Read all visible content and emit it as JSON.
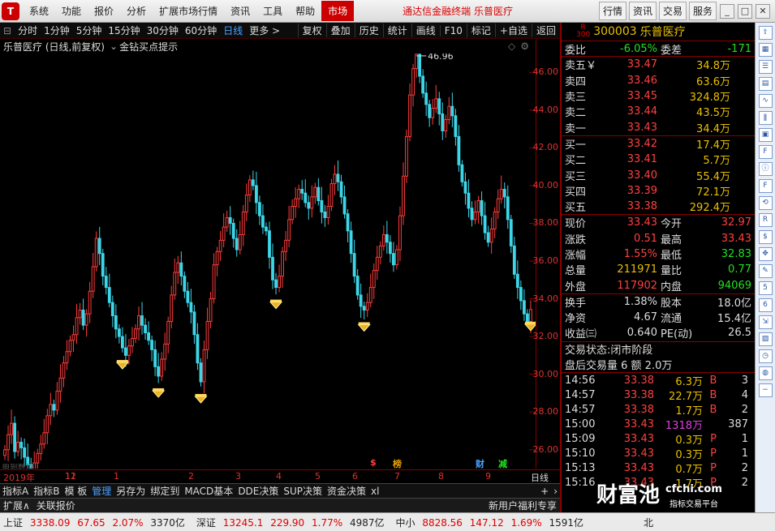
{
  "menubar": {
    "items": [
      "系统",
      "功能",
      "报价",
      "分析",
      "扩展市场行情",
      "资讯",
      "工具",
      "帮助"
    ],
    "market": "市场",
    "app_title": "通达信金融终端  乐普医疗",
    "right_buttons": [
      "行情",
      "资讯",
      "交易",
      "服务"
    ]
  },
  "toolbar": {
    "periods": [
      "分时",
      "1分钟",
      "5分钟",
      "15分钟",
      "30分钟",
      "60分钟",
      "日线",
      "更多 >"
    ],
    "active_period": "日线",
    "buttons": [
      "复权",
      "叠加",
      "历史",
      "统计",
      "画线",
      "F10",
      "标记",
      "+自选",
      "返回"
    ]
  },
  "chart": {
    "title": "乐普医疗 (日线,前复权)",
    "indicator": "金钻买点提示",
    "high_label": "46.96",
    "low_label": "24.80",
    "fade_text": "用到数据",
    "y_ticks": [
      "46.00",
      "44.00",
      "42.00",
      "40.00",
      "38.00",
      "36.00",
      "34.00",
      "32.00",
      "30.00",
      "28.00",
      "26.00"
    ],
    "x_labels": [
      "2019年",
      "11",
      "12",
      "1",
      "2",
      "3",
      "4",
      "5",
      "6",
      "7",
      "8",
      "9"
    ],
    "period_label": "日线",
    "events": [
      {
        "text": "$",
        "color": "#ff4040"
      },
      {
        "text": "榜",
        "color": "#e8a000"
      },
      {
        "text": "财",
        "color": "#4aa3ff"
      },
      {
        "text": "减",
        "color": "#22e022"
      }
    ]
  },
  "chart_data": {
    "type": "candlestick",
    "ylim": [
      25,
      47
    ],
    "high": 46.96,
    "low": 24.8,
    "closes": [
      26.0,
      26.8,
      27.4,
      25.9,
      26.4,
      26.1,
      25.6,
      25.2,
      24.9,
      25.3,
      25.8,
      26.3,
      26.9,
      27.8,
      28.4,
      28.1,
      29.1,
      29.8,
      30.6,
      31.2,
      31.8,
      32.1,
      33.0,
      33.4,
      32.6,
      33.2,
      34.4,
      35.7,
      37.2,
      36.4,
      35.2,
      34.6,
      33.8,
      33.1,
      32.4,
      32.0,
      31.4,
      31.0,
      31.5,
      31.9,
      32.4,
      33.1,
      32.6,
      32.2,
      31.8,
      31.3,
      30.4,
      29.9,
      30.8,
      31.6,
      32.8,
      34.2,
      35.4,
      35.9,
      35.2,
      34.4,
      33.8,
      33.3,
      32.1,
      30.6,
      29.6,
      31.3,
      32.8,
      34.0,
      35.8,
      36.5,
      37.1,
      37.8,
      38.3,
      38.0,
      37.2,
      36.6,
      37.4,
      38.6,
      39.5,
      40.3,
      40.0,
      39.1,
      38.4,
      37.8,
      37.6,
      36.2,
      35.0,
      34.6,
      35.2,
      36.5,
      37.1,
      38.2,
      38.9,
      39.3,
      39.8,
      39.6,
      39.1,
      38.8,
      39.4,
      39.9,
      39.2,
      38.6,
      38.3,
      38.9,
      40.1,
      40.6,
      40.2,
      39.4,
      38.5,
      37.6,
      36.4,
      35.2,
      34.2,
      33.6,
      33.4,
      33.8,
      34.6,
      35.5,
      36.2,
      36.8,
      37.4,
      37.0,
      36.4,
      35.8,
      36.6,
      38.4,
      40.5,
      42.6,
      44.8,
      46.2,
      46.96,
      45.8,
      44.9,
      44.3,
      43.6,
      44.1,
      44.6,
      43.8,
      42.9,
      43.5,
      44.2,
      43.7,
      42.6,
      41.1,
      40.2,
      39.6,
      38.8,
      38.2,
      38.6,
      39.2,
      38.4,
      37.5,
      37.0,
      37.7,
      38.6,
      39.3,
      39.8,
      39.4,
      38.2,
      36.8,
      35.3,
      34.6,
      33.9,
      33.2,
      32.8,
      33.43
    ]
  },
  "quote": {
    "stock_code": "300003",
    "stock_name": "乐普医疗",
    "r_mark": "R",
    "r_num": "300",
    "weibi_label": "委比",
    "weibi": "-6.05%",
    "weicha_label": "委差",
    "weicha": "-171",
    "asks": [
      {
        "label": "卖五￥",
        "price": "33.47",
        "vol": "34.8万"
      },
      {
        "label": "卖四",
        "price": "33.46",
        "vol": "63.6万"
      },
      {
        "label": "卖三",
        "price": "33.45",
        "vol": "324.8万"
      },
      {
        "label": "卖二",
        "price": "33.44",
        "vol": "43.5万"
      },
      {
        "label": "卖一",
        "price": "33.43",
        "vol": "34.4万"
      }
    ],
    "bids": [
      {
        "label": "买一",
        "price": "33.42",
        "vol": "17.4万"
      },
      {
        "label": "买二",
        "price": "33.41",
        "vol": "5.7万"
      },
      {
        "label": "买三",
        "price": "33.40",
        "vol": "55.4万"
      },
      {
        "label": "买四",
        "price": "33.39",
        "vol": "72.1万"
      },
      {
        "label": "买五",
        "price": "33.38",
        "vol": "292.4万"
      }
    ],
    "stats": [
      {
        "l1": "现价",
        "v1": "33.43",
        "c1": "red",
        "l2": "今开",
        "v2": "32.97",
        "c2": "red"
      },
      {
        "l1": "涨跌",
        "v1": "0.51",
        "c1": "red",
        "l2": "最高",
        "v2": "33.43",
        "c2": "red"
      },
      {
        "l1": "涨幅",
        "v1": "1.55%",
        "c1": "red",
        "l2": "最低",
        "v2": "32.83",
        "c2": "green"
      },
      {
        "l1": "总量",
        "v1": "211971",
        "c1": "yellow",
        "l2": "量比",
        "v2": "0.77",
        "c2": "green"
      },
      {
        "l1": "外盘",
        "v1": "117902",
        "c1": "red",
        "l2": "内盘",
        "v2": "94069",
        "c2": "green"
      }
    ],
    "stats2": [
      {
        "l1": "换手",
        "v1": "1.38%",
        "l2": "股本",
        "v2": "18.0亿"
      },
      {
        "l1": "净资",
        "v1": "4.67",
        "l2": "流通",
        "v2": "15.4亿"
      },
      {
        "l1": "收益㈢",
        "v1": "0.640",
        "l2": "PE(动)",
        "v2": "26.5"
      }
    ],
    "trade_status": "交易状态:闭市阶段",
    "after_hours": "盘后交易量 6 额 2.0万",
    "ticks": [
      {
        "time": "14:56",
        "price": "33.38",
        "vol": "6.3万",
        "bs": "B",
        "n": "3",
        "vc": "yellow"
      },
      {
        "time": "14:57",
        "price": "33.38",
        "vol": "22.7万",
        "bs": "B",
        "n": "4",
        "vc": "yellow"
      },
      {
        "time": "14:57",
        "price": "33.38",
        "vol": "1.7万",
        "bs": "B",
        "n": "2",
        "vc": "yellow"
      },
      {
        "time": "15:00",
        "price": "33.43",
        "vol": "1318万",
        "bs": "",
        "n": "387",
        "vc": "magenta"
      },
      {
        "time": "15:09",
        "price": "33.43",
        "vol": "0.3万",
        "bs": "P",
        "n": "1",
        "vc": "yellow"
      },
      {
        "time": "15:10",
        "price": "33.43",
        "vol": "0.3万",
        "bs": "P",
        "n": "1",
        "vc": "yellow"
      },
      {
        "time": "15:13",
        "price": "33.43",
        "vol": "0.7万",
        "bs": "P",
        "n": "2",
        "vc": "yellow"
      },
      {
        "time": "15:16",
        "price": "33.43",
        "vol": "1.7万",
        "bs": "P",
        "n": "2",
        "vc": "yellow"
      }
    ]
  },
  "bottom_tabs": [
    "指标A",
    "指标B",
    "模 板",
    "管理",
    "另存为",
    "绑定到",
    "MACD基本",
    "DDE决策",
    "SUP决策",
    "资金决策",
    "xl"
  ],
  "active_tab": "管理",
  "ext_bar": {
    "left": "扩展∧",
    "related": "关联报价",
    "promo": "新用户福利专享",
    "pen": "笔",
    "price": "价",
    "detail": "细",
    "cost": "值"
  },
  "statusbar": [
    {
      "name": "上证",
      "v1": "3338.09",
      "v2": "67.65",
      "v3": "2.07%",
      "v4": "3370亿"
    },
    {
      "name": "深证",
      "v1": "13245.1",
      "v2": "229.90",
      "v3": "1.77%",
      "v4": "4987亿"
    },
    {
      "name": "中小",
      "v1": "8828.56",
      "v2": "147.12",
      "v3": "1.69%",
      "v4": "1591亿"
    }
  ],
  "status_extra": "北",
  "watermark": "财富池",
  "watermark2": "cfchi.com",
  "watermark3": "指标交易平台",
  "side_icons": [
    "up-arrow-icon",
    "grid-icon",
    "list-icon",
    "table-icon",
    "line-chart-icon",
    "candle-icon",
    "block-icon",
    "f10-icon",
    "info-icon",
    "f12-icon",
    "sync-icon",
    "rsi-icon",
    "dollar-icon",
    "move-icon",
    "pen-icon",
    "f5-icon",
    "f6-icon",
    "export-icon",
    "image-icon",
    "clock-icon",
    "ring-icon",
    "minus-icon"
  ],
  "side_labels": [
    "RSI",
    "$",
    "F5",
    "F6",
    "F10",
    "F12"
  ]
}
